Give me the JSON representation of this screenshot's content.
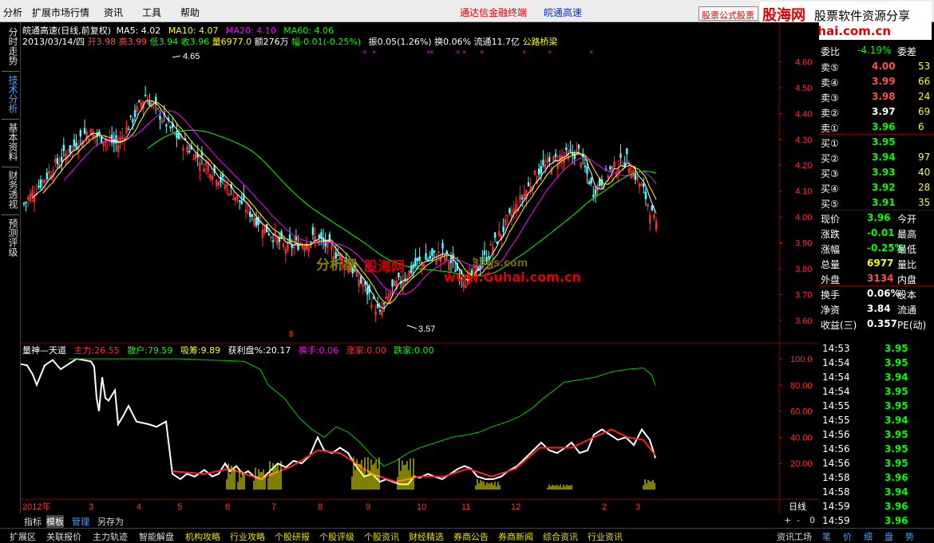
{
  "menu": {
    "items": [
      "分析",
      "扩展市场行情",
      "资讯",
      "工具",
      "帮助"
    ],
    "promo_left": "通达信金融终端",
    "promo_right": "皖通高速",
    "ad_box": "股票公式股票"
  },
  "brand": {
    "logo": "股海网",
    "slogan": "股票软件资源分享",
    "url": "www.Guhai.com.cn"
  },
  "left_tabs": [
    "分时走势",
    "技术分析",
    "基本资料",
    "财务透视",
    "预测评级"
  ],
  "main_chart": {
    "title_line": "皖通高速(日线,前复权)",
    "ma": [
      {
        "label": "MA5: 4.02",
        "color": "#ffffff"
      },
      {
        "label": "MA10: 4.07",
        "color": "#ffff00"
      },
      {
        "label": "MA20: 4.10",
        "color": "#ff00ff"
      },
      {
        "label": "MA60: 4.06",
        "color": "#00ff00"
      }
    ],
    "date": "2013/03/14/四",
    "open_label": "开",
    "open": "3.98",
    "high_label": "高",
    "high": "3.99",
    "low_label": "低",
    "low": "3.94",
    "close_label": "收",
    "close": "3.96",
    "vol_label": "量",
    "vol": "6977.0",
    "amt_label": "额",
    "amt": "276万",
    "chg_label": "幅",
    "chg": "-0.01(-0.25%)",
    "amp_label": "振",
    "amp": "0.05(1.26%)",
    "turn_label": "换",
    "turn": "0.06%",
    "float_label": "流通",
    "float": "11.7亿",
    "sector": "公路桥梁",
    "max_label": "4.65",
    "min_label": "3.57",
    "y_ticks": [
      "4.60",
      "4.50",
      "4.40",
      "4.30",
      "4.20",
      "4.10",
      "4.00",
      "3.90",
      "3.80",
      "3.70",
      "3.60"
    ]
  },
  "sub_chart": {
    "name": "量神—天道",
    "indicators": [
      {
        "label": "主力:",
        "value": "26.55",
        "color": "#ff3030"
      },
      {
        "label": "散户:",
        "value": "79.59",
        "color": "#00ff00"
      },
      {
        "label": "吸筹:",
        "value": "9.89",
        "color": "#ffff00"
      },
      {
        "label": "获利盘%:",
        "value": "20.17",
        "color": "#ffffff"
      },
      {
        "label": "换手:",
        "value": "0.06",
        "color": "#ff00ff"
      },
      {
        "label": "涨家:",
        "value": "0.00",
        "color": "#ff3030"
      },
      {
        "label": "跌家:",
        "value": "0.00",
        "color": "#00ff00"
      }
    ],
    "y_ticks": [
      "100.0",
      "80.00",
      "60.00",
      "40.00",
      "20.00"
    ]
  },
  "x_axis": {
    "labels": [
      "2012年",
      "3",
      "4",
      "5",
      "6",
      "7",
      "8",
      "9",
      "10",
      "11",
      "12",
      "2",
      "3"
    ],
    "period": "日线"
  },
  "quote": {
    "weibi_label": "委比",
    "weibi": "-4.19%",
    "weicha_label": "委差",
    "sells": [
      {
        "label": "卖⑤",
        "price": "4.00",
        "vol": "53",
        "color": "#ff5050"
      },
      {
        "label": "卖④",
        "price": "3.99",
        "vol": "66",
        "color": "#ff5050"
      },
      {
        "label": "卖③",
        "price": "3.98",
        "vol": "24",
        "color": "#ff5050"
      },
      {
        "label": "卖②",
        "price": "3.97",
        "vol": "69",
        "color": "#ffffff"
      },
      {
        "label": "卖①",
        "price": "3.96",
        "vol": "6",
        "color": "#00ff00"
      }
    ],
    "buys": [
      {
        "label": "买①",
        "price": "3.95",
        "vol": "",
        "color": "#00ff00"
      },
      {
        "label": "买②",
        "price": "3.94",
        "vol": "97",
        "color": "#00ff00"
      },
      {
        "label": "买③",
        "price": "3.93",
        "vol": "40",
        "color": "#00ff00"
      },
      {
        "label": "买④",
        "price": "3.92",
        "vol": "28",
        "color": "#00ff00"
      },
      {
        "label": "买⑤",
        "price": "3.91",
        "vol": "35",
        "color": "#00ff00"
      }
    ],
    "stats": [
      {
        "label": "现价",
        "value": "3.96",
        "color": "#00ff00",
        "right": "今开"
      },
      {
        "label": "涨跌",
        "value": "-0.01",
        "color": "#00ff00",
        "right": "最高"
      },
      {
        "label": "涨幅",
        "value": "-0.25%",
        "color": "#00ff00",
        "right": "最低"
      },
      {
        "label": "总量",
        "value": "6977",
        "color": "#ffff00",
        "right": "量比"
      },
      {
        "label": "外盘",
        "value": "3134",
        "color": "#ff5050",
        "right": "内盘"
      },
      {
        "label": "换手",
        "value": "0.06%",
        "color": "#ffffff",
        "right": "股本"
      },
      {
        "label": "净资",
        "value": "3.84",
        "color": "#ffffff",
        "right": "流通"
      },
      {
        "label": "收益(三)",
        "value": "0.357",
        "color": "#ffffff",
        "right": "PE(动)"
      }
    ]
  },
  "ticks": [
    {
      "t": "14:53",
      "p": "3.95",
      "c": "#00ff00"
    },
    {
      "t": "14:54",
      "p": "3.95",
      "c": "#00ff00"
    },
    {
      "t": "14:54",
      "p": "3.94",
      "c": "#00ff00"
    },
    {
      "t": "14:54",
      "p": "3.95",
      "c": "#00ff00"
    },
    {
      "t": "14:55",
      "p": "3.95",
      "c": "#00ff00"
    },
    {
      "t": "14:55",
      "p": "3.94",
      "c": "#00ff00"
    },
    {
      "t": "14:56",
      "p": "3.95",
      "c": "#00ff00"
    },
    {
      "t": "14:56",
      "p": "3.95",
      "c": "#00ff00"
    },
    {
      "t": "14:56",
      "p": "3.95",
      "c": "#00ff00"
    },
    {
      "t": "14:58",
      "p": "3.96",
      "c": "#00ff00"
    },
    {
      "t": "14:58",
      "p": "3.94",
      "c": "#00ff00"
    },
    {
      "t": "14:59",
      "p": "3.96",
      "c": "#00ff00"
    },
    {
      "t": "14:59",
      "p": "3.96",
      "c": "#00ff00"
    }
  ],
  "bottom_tabs": [
    "指标",
    "模板",
    "管理",
    "另存为"
  ],
  "zoom_controls": [
    "+",
    "-",
    "0"
  ],
  "footer_left": [
    "扩展区",
    "关联报价",
    "主力轨迹",
    "智能解盘"
  ],
  "footer_right": [
    "机构攻略",
    "行业攻略",
    "个股研报",
    "个股评级",
    "个股资讯",
    "财经精选",
    "券商公告",
    "券商新闻",
    "综合资讯",
    "行业资讯"
  ],
  "footer_corner": "资讯工场",
  "footer_mini": [
    "笔",
    "价",
    "细",
    "盘",
    "势"
  ],
  "watermarks": {
    "text1": "分析家",
    "text2": "股海网",
    "text3": "www.Guhai.com.cn",
    "text4": "38gs.com"
  }
}
